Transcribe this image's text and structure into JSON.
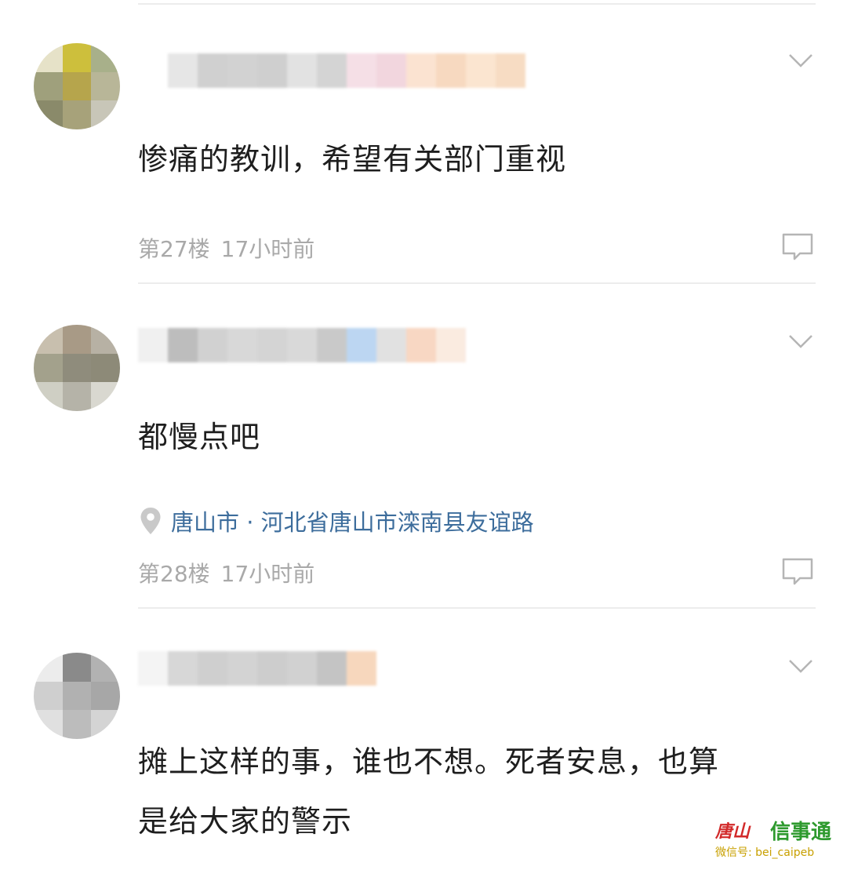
{
  "comments": [
    {
      "text": "惨痛的教训，希望有关部门重视",
      "floor": "第27楼",
      "time": "17小时前",
      "location": null,
      "avatar_colors": [
        "#e6e2c8",
        "#cdbf3c",
        "#a8b08a",
        "#9fa07c",
        "#b6a54c",
        "#b8b698",
        "#8a8a6a",
        "#a7a27a",
        "#c8c6b8"
      ],
      "username_blur_colors": [
        "#ffffff",
        "#e6e6e6",
        "#d0d0d0",
        "#d2d2d2",
        "#cfcfcf",
        "#e2e2e2",
        "#d4d4d4",
        "#f5dfe6",
        "#f2d6de",
        "#fbe3d1",
        "#f7d9c0",
        "#fbe5d0",
        "#f7dcc3"
      ]
    },
    {
      "text": "都慢点吧",
      "floor": "第28楼",
      "time": "17小时前",
      "location": "唐山市 · 河北省唐山市滦南县友谊路",
      "avatar_colors": [
        "#c8bfae",
        "#a89a86",
        "#b7b1a4",
        "#a3a18c",
        "#8f8c7c",
        "#8d8a78",
        "#cfcfc4",
        "#b5b3a8",
        "#d9d8d0"
      ],
      "username_blur_colors": [
        "#f0f0f0",
        "#bdbdbd",
        "#d1d1d1",
        "#d8d8d8",
        "#d4d4d4",
        "#d9d9d9",
        "#c9c9c9",
        "#bcd6f2",
        "#e1e1e1",
        "#f8d7c3",
        "#faebe0"
      ]
    },
    {
      "text": "摊上这样的事，谁也不想。死者安息，也算是给大家的警示",
      "text_lines": [
        "摊上这样的事，谁也不想。死者安息，也算",
        "是给大家的警示"
      ],
      "avatar_colors": [
        "#ececec",
        "#8a8a8a",
        "#b2b2b2",
        "#cfcfcf",
        "#b1b1b1",
        "#a7a7a7",
        "#e0e0e0",
        "#bcbcbc",
        "#d4d4d4"
      ],
      "username_blur_colors": [
        "#f4f4f4",
        "#d7d7d7",
        "#cfcfcf",
        "#d3d3d3",
        "#cdcdcd",
        "#d1d1d1",
        "#c4c4c4",
        "#f7d7bd"
      ]
    }
  ],
  "icons": {
    "expand": "chevron-down-icon",
    "reply": "comment-bubble-icon",
    "location": "location-pin-icon"
  },
  "colors": {
    "comment_text": "#1e1e1e",
    "meta_text": "#a9a9a9",
    "location_text": "#3d6d9c",
    "divider": "#ececec"
  }
}
